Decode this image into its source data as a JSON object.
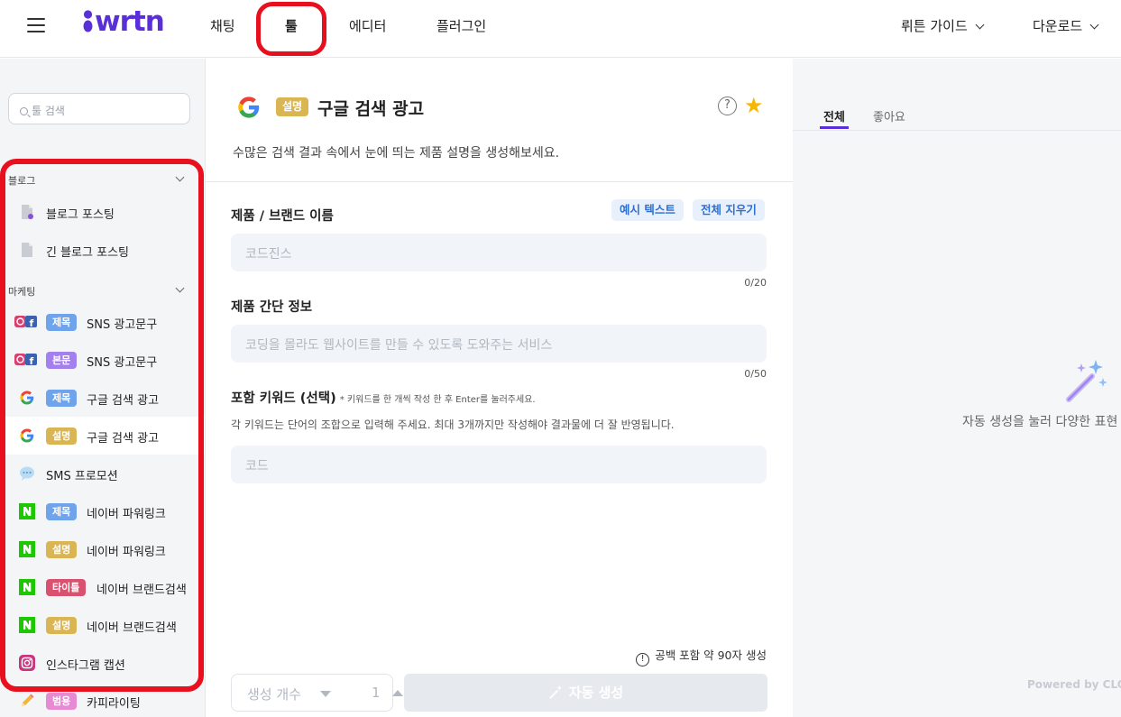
{
  "topbar": {
    "logo": "wrtn",
    "nav": [
      "채팅",
      "툴",
      "에디터",
      "플러그인"
    ],
    "guide": "뤼튼 가이드",
    "download": "다운로드"
  },
  "sidebar": {
    "search_placeholder": "툴 검색",
    "groups": [
      {
        "title": "블로그"
      },
      {
        "title": "마케팅"
      }
    ],
    "items": [
      {
        "badge": "",
        "label": "블로그 포스팅"
      },
      {
        "badge": "",
        "label": "긴 블로그 포스팅"
      },
      {
        "badge": "제목",
        "label": "SNS 광고문구"
      },
      {
        "badge": "본문",
        "label": "SNS 광고문구"
      },
      {
        "badge": "제목",
        "label": "구글 검색 광고"
      },
      {
        "badge": "설명",
        "label": "구글 검색 광고"
      },
      {
        "badge": "",
        "label": "SMS 프로모션"
      },
      {
        "badge": "제목",
        "label": "네이버 파워링크"
      },
      {
        "badge": "설명",
        "label": "네이버 파워링크"
      },
      {
        "badge": "타이틀",
        "label": "네이버 브랜드검색"
      },
      {
        "badge": "설명",
        "label": "네이버 브랜드검색"
      },
      {
        "badge": "",
        "label": "인스타그램 캡션"
      },
      {
        "badge": "범용",
        "label": "카피라이팅"
      }
    ],
    "colors": {
      "highlight": "#e8101e",
      "brand": "#5a2fd8"
    }
  },
  "tool": {
    "badge": "설명",
    "title": "구글 검색 광고",
    "description": "수많은 검색 결과 속에서 눈에 띄는 제품 설명을 생성해보세요.",
    "example_btn": "예시 텍스트",
    "clear_btn": "전체 지우기",
    "fields": [
      {
        "label": "제품 / 브랜드 이름",
        "placeholder": "코드진스",
        "counter": "0/20"
      },
      {
        "label": "제품 간단 정보",
        "placeholder": "코딩을 몰라도 웹사이트를 만들 수 있도록 도와주는 서비스",
        "counter": "0/50"
      },
      {
        "label": "포함 키워드 (선택)",
        "note": "* 키워드를 한 개씩 작성 한 후 Enter를 눌러주세요.",
        "hint": "각 키워드는 단어의 조합으로 입력해 주세요. 최대 3개까지만 작성해야 결과물에 더 잘 반영됩니다.",
        "placeholder": "코드"
      }
    ],
    "length_info": "공백 포함 약 90자 생성",
    "count_label": "생성 개수",
    "count_value": "1",
    "generate_btn": "자동 생성"
  },
  "results": {
    "tabs": [
      "전체",
      "좋아요"
    ],
    "empty_message": "자동 생성을 눌러 다양한 표현",
    "powered": "Powered by CLO"
  }
}
